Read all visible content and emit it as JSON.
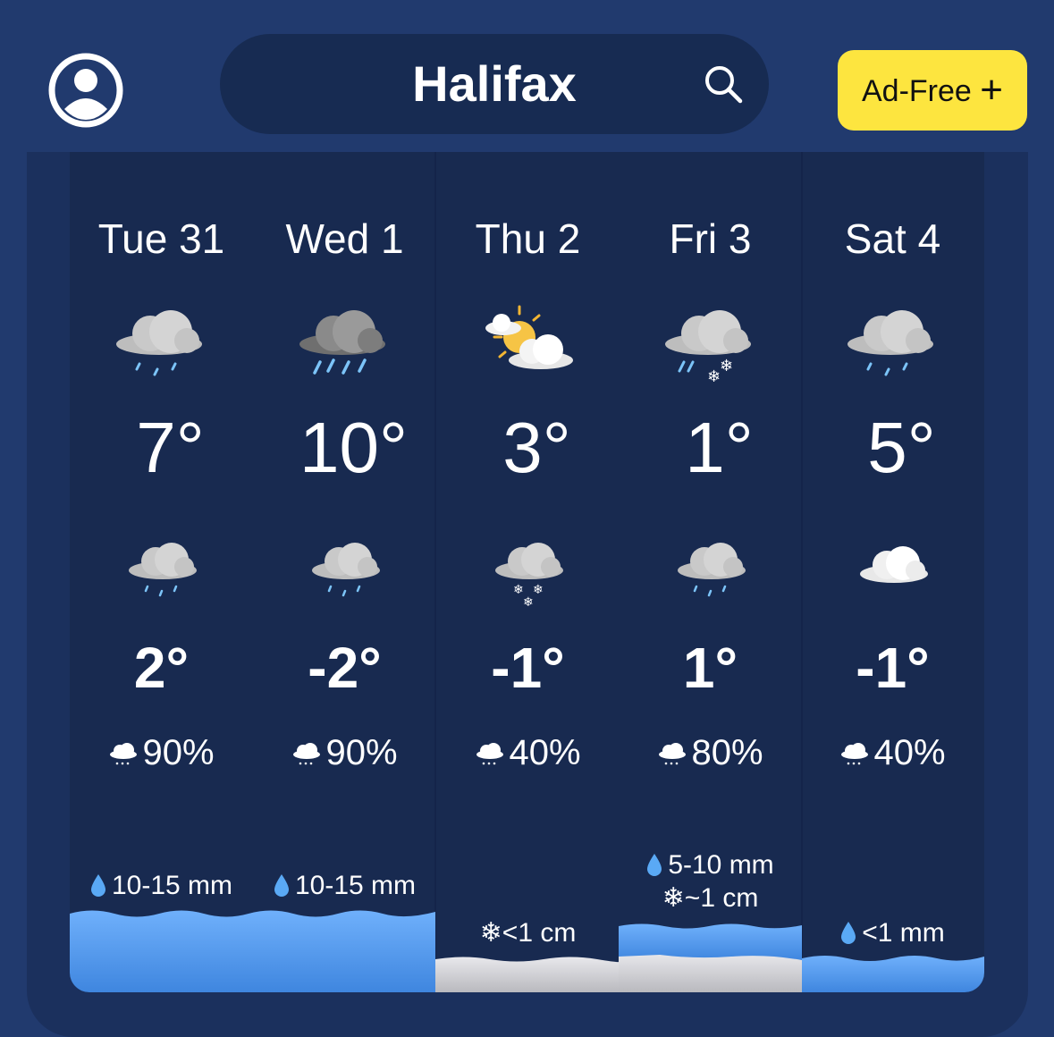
{
  "header": {
    "city": "Halifax",
    "ad_free_label": "Ad-Free",
    "ad_free_plus": "+"
  },
  "days": [
    {
      "label": "Tue 31",
      "high": "7°",
      "low": "2°",
      "pop": "90%",
      "amount": "10-15 mm",
      "amount2": "",
      "day_icon": "rain-cloud-icon",
      "night_icon": "rain-cloud-icon",
      "precip_type": "rain",
      "precip_level": 0.95
    },
    {
      "label": "Wed 1",
      "high": "10°",
      "low": "-2°",
      "pop": "90%",
      "amount": "10-15 mm",
      "amount2": "",
      "day_icon": "heavy-rain-cloud-icon",
      "night_icon": "rain-cloud-icon",
      "precip_type": "rain",
      "precip_level": 0.95
    },
    {
      "label": "Thu 2",
      "high": "3°",
      "low": "-1°",
      "pop": "40%",
      "amount": "",
      "amount2": "<1 cm",
      "day_icon": "sun-cloud-icon",
      "night_icon": "snow-cloud-icon",
      "precip_type": "snow",
      "precip_level": 0.4
    },
    {
      "label": "Fri 3",
      "high": "1°",
      "low": "1°",
      "pop": "80%",
      "amount": "5-10 mm",
      "amount2": "~1 cm",
      "day_icon": "rain-snow-cloud-icon",
      "night_icon": "rain-cloud-icon",
      "precip_type": "mixed",
      "precip_level": 0.8
    },
    {
      "label": "Sat 4",
      "high": "5°",
      "low": "-1°",
      "pop": "40%",
      "amount": "<1 mm",
      "amount2": "",
      "day_icon": "rain-cloud-icon",
      "night_icon": "cloud-icon",
      "precip_type": "rain",
      "precip_level": 0.4
    }
  ],
  "colors": {
    "background": "#213a6e",
    "card": "#182a50",
    "ad_free": "#fde53f",
    "rain": "#4a90e2",
    "snow": "#d0d0d4"
  }
}
